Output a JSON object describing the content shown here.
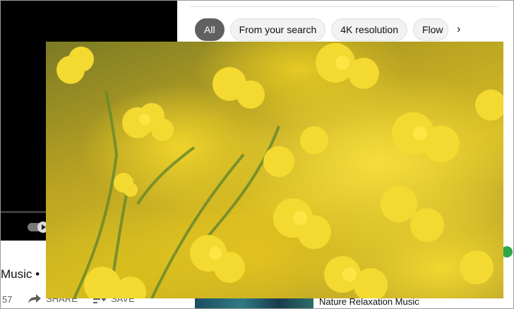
{
  "video": {
    "title": "Music •",
    "count": "57",
    "share_label": "SHARE",
    "save_label": "SAVE",
    "more_label": "•••"
  },
  "chips": [
    {
      "label": "All",
      "active": true
    },
    {
      "label": "From your search",
      "active": false
    },
    {
      "label": "4K resolution",
      "active": false
    },
    {
      "label": "Flow",
      "active": false
    }
  ],
  "chips_next": "›",
  "related": {
    "title": "Nature Relaxation Music"
  },
  "colors": {
    "accent_chip": "#606060",
    "flower_yellow": "#f2d62e",
    "stem_green": "#6f8f2a"
  }
}
